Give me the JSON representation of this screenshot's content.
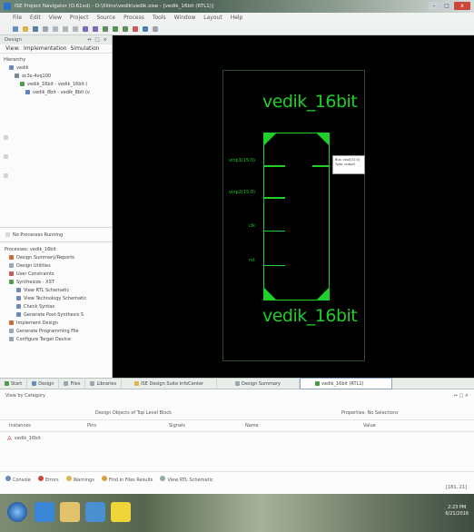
{
  "window": {
    "title": "ISE Project Navigator (O.61xd) - D:\\Xilinx\\vedik\\vedik.xise - [vedik_16bit (RTL1)]",
    "controls": [
      "–",
      "□",
      "x"
    ]
  },
  "menu": [
    "File",
    "Edit",
    "View",
    "Project",
    "Source",
    "Process",
    "Tools",
    "Window",
    "Layout",
    "Help"
  ],
  "left_panel": {
    "design_header": "Design",
    "view_labels": [
      "View:",
      "Implementation",
      "Simulation"
    ],
    "hierarchy_label": "Hierarchy",
    "hierarchy_items": [
      "vedik",
      "xc3s-4vq100",
      "vedik_16bit - vedik_16bit (",
      "vedik_8bit - vedik_8bit (v"
    ],
    "processes_header": "Processes: vedik_16bit",
    "no_processes": "No Processes Running",
    "process_items": [
      "Design Summary/Reports",
      "Design Utilities",
      "User Constraints",
      "Synthesize - XST",
      "View RTL Schematic",
      "View Technology Schematic",
      "Check Syntax",
      "Generate Post-Synthesis S",
      "Implement Design",
      "Generate Programming File",
      "Configure Target Device"
    ]
  },
  "schematic": {
    "block_name": "vedik_16bit",
    "pins": [
      "vinp1(15:0)",
      "vinp2(15:0)",
      "clk",
      "rst"
    ],
    "output_tooltip": [
      "Bus: vout[31:0]",
      "Type: output"
    ]
  },
  "tabs": [
    {
      "label": "Start"
    },
    {
      "label": "Design"
    },
    {
      "label": "Files"
    },
    {
      "label": "Libraries"
    },
    {
      "label": "ISE Design Suite InfoCenter"
    },
    {
      "label": "Design Summary"
    },
    {
      "label": "vedik_16bit (RTL1)"
    }
  ],
  "bottom_panel": {
    "header": "View by Category",
    "left_title": "Design Objects of Top Level Block",
    "right_title": "Properties: No Selections",
    "columns": [
      "Instances",
      "Pins",
      "Signals",
      "Name",
      "Value"
    ],
    "instance": "vedik_16bit",
    "status_tabs": [
      "Console",
      "Errors",
      "Warnings",
      "Find in Files Results",
      "View RTL Schematic"
    ],
    "coords": "[181, 21]"
  },
  "taskbar": {
    "time": "2:23 PM",
    "date": "6/21/2016"
  }
}
